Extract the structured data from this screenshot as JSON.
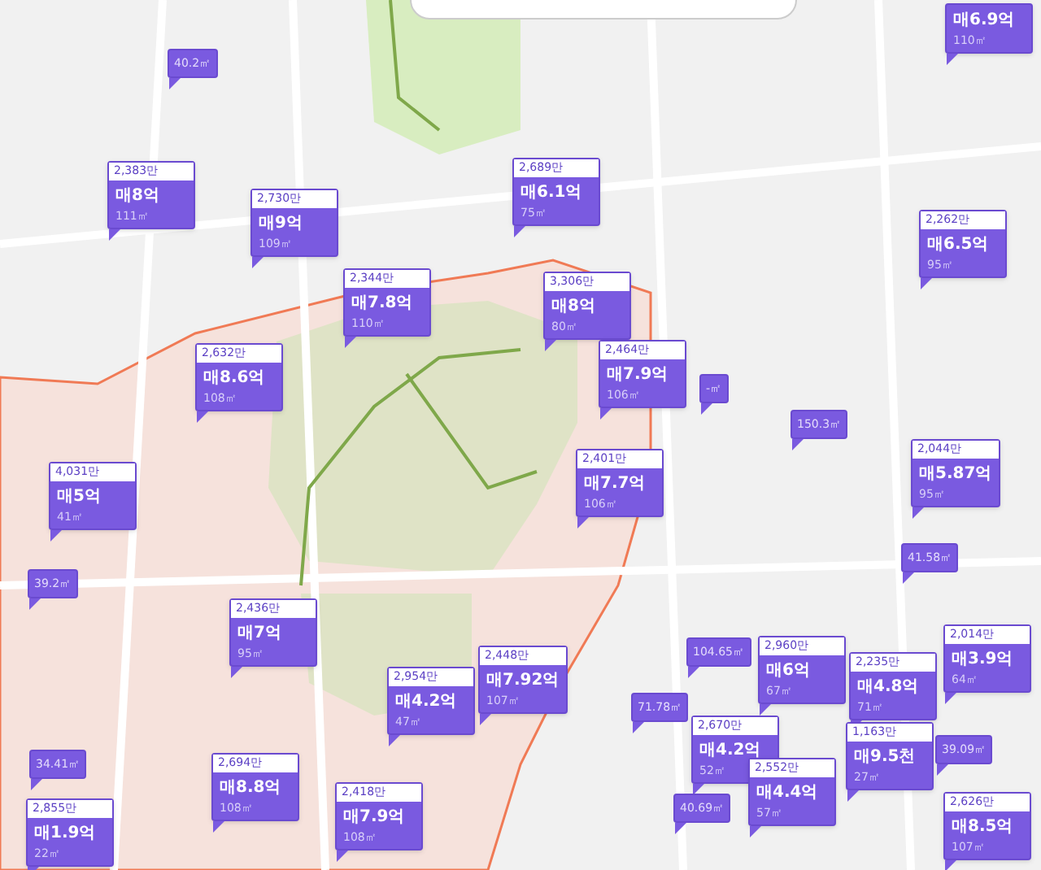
{
  "markers": [
    {
      "kind": "area",
      "area": "40.2㎡"
    },
    {
      "kind": "sale",
      "unit_price": "2,383만",
      "price": "매8억",
      "area": "111㎡"
    },
    {
      "kind": "sale",
      "unit_price": "2,730만",
      "price": "매9억",
      "area": "109㎡"
    },
    {
      "kind": "sale",
      "unit_price": "2,689만",
      "price": "매6.1억",
      "area": "75㎡"
    },
    {
      "kind": "sale",
      "price": "매6.9억",
      "area": "110㎡"
    },
    {
      "kind": "sale",
      "unit_price": "2,262만",
      "price": "매6.5억",
      "area": "95㎡"
    },
    {
      "kind": "sale",
      "unit_price": "2,344만",
      "price": "매7.8억",
      "area": "110㎡"
    },
    {
      "kind": "sale",
      "unit_price": "3,306만",
      "price": "매8억",
      "area": "80㎡"
    },
    {
      "kind": "sale",
      "unit_price": "2,632만",
      "price": "매8.6억",
      "area": "108㎡"
    },
    {
      "kind": "sale",
      "unit_price": "2,464만",
      "price": "매7.9억",
      "area": "106㎡"
    },
    {
      "kind": "area",
      "area": "-㎡"
    },
    {
      "kind": "area",
      "area": "150.3㎡"
    },
    {
      "kind": "sale",
      "unit_price": "2,044만",
      "price": "매5.87억",
      "area": "95㎡"
    },
    {
      "kind": "sale",
      "unit_price": "2,401만",
      "price": "매7.7억",
      "area": "106㎡"
    },
    {
      "kind": "sale",
      "unit_price": "4,031만",
      "price": "매5억",
      "area": "41㎡"
    },
    {
      "kind": "area",
      "area": "41.58㎡"
    },
    {
      "kind": "area",
      "area": "39.2㎡"
    },
    {
      "kind": "sale",
      "unit_price": "2,436만",
      "price": "매7억",
      "area": "95㎡"
    },
    {
      "kind": "sale",
      "unit_price": "2,954만",
      "price": "매4.2억",
      "area": "47㎡"
    },
    {
      "kind": "sale",
      "unit_price": "2,448만",
      "price": "매7.92억",
      "area": "107㎡"
    },
    {
      "kind": "area",
      "area": "104.65㎡"
    },
    {
      "kind": "sale",
      "unit_price": "2,960만",
      "price": "매6억",
      "area": "67㎡"
    },
    {
      "kind": "sale",
      "unit_price": "2,235만",
      "price": "매4.8억",
      "area": "71㎡"
    },
    {
      "kind": "sale",
      "unit_price": "2,014만",
      "price": "매3.9억",
      "area": "64㎡"
    },
    {
      "kind": "area",
      "area": "34.41㎡"
    },
    {
      "kind": "sale",
      "unit_price": "2,694만",
      "price": "매8.8억",
      "area": "108㎡"
    },
    {
      "kind": "area",
      "area": "71.78㎡"
    },
    {
      "kind": "sale",
      "unit_price": "2,670만",
      "price": "매4.2억",
      "area": "52㎡"
    },
    {
      "kind": "sale",
      "unit_price": "2,552만",
      "price": "매4.4억",
      "area": "57㎡"
    },
    {
      "kind": "sale",
      "unit_price": "1,163만",
      "price": "매9.5천",
      "area": "27㎡"
    },
    {
      "kind": "area",
      "area": "39.09㎡"
    },
    {
      "kind": "sale",
      "unit_price": "2,855만",
      "price": "매1.9억",
      "area": "22㎡"
    },
    {
      "kind": "sale",
      "unit_price": "2,418만",
      "price": "매7.9억",
      "area": "108㎡"
    },
    {
      "kind": "area",
      "area": "40.69㎡"
    },
    {
      "kind": "sale",
      "unit_price": "2,626만",
      "price": "매8.5억",
      "area": "107㎡"
    }
  ]
}
